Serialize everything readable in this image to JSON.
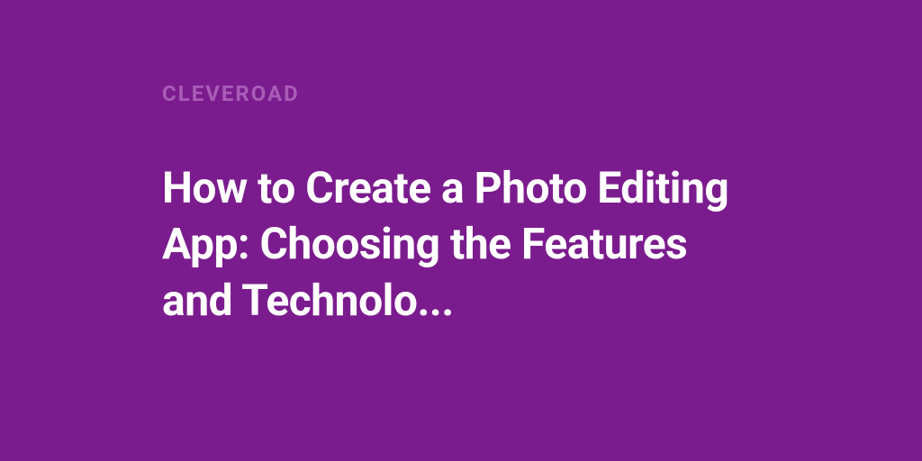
{
  "brand": "CLEVEROAD",
  "title": "How to Create a Photo Editing App: Choosing the Features and Technolo..."
}
